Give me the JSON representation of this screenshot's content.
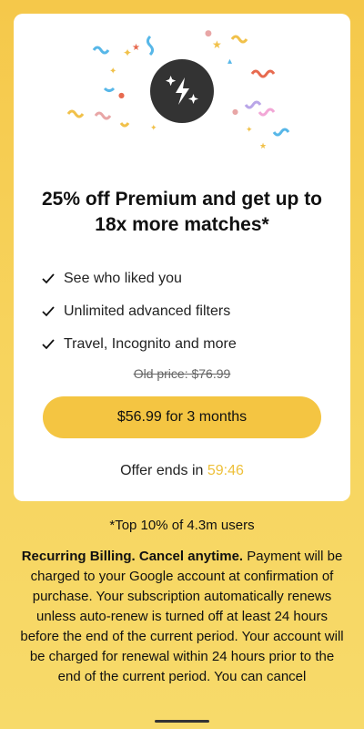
{
  "offer_card": {
    "title": "25% off Premium and get up to 18x more matches*",
    "features": [
      "See who liked you",
      "Unlimited advanced filters",
      "Travel, Incognito and more"
    ],
    "old_price": "Old price: $76.99",
    "cta_label": "$56.99 for 3 months",
    "offer_ends_label": "Offer ends in ",
    "timer": "59:46"
  },
  "footnote": "*Top 10% of 4.3m users",
  "legal": {
    "heading": "Recurring Billing. Cancel anytime.",
    "body": " Payment will be charged to your Google account at confirmation of purchase. Your subscription automatically renews unless auto-renew is turned off at least 24 hours before the end of the current period. Your account will be charged for renewal within 24 hours prior to the end of the current period. You can cancel"
  },
  "colors": {
    "accent": "#f4c542",
    "timer": "#eec03a",
    "background": "#f7d35c"
  },
  "icons": {
    "badge": "lightning-sparkle-icon",
    "check": "check-icon"
  }
}
